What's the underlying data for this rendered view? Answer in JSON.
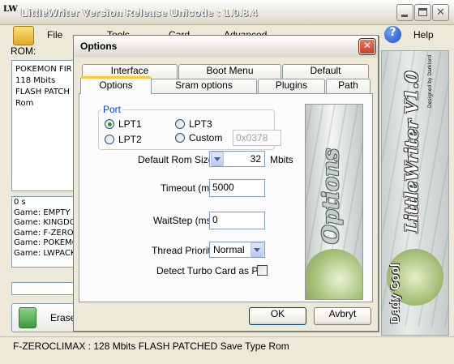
{
  "app": {
    "icon_text": "LW",
    "title": "LittleWriter Version Release Unicode : 1.0.8.4",
    "window_buttons": [
      "minimize-icon",
      "maximize-icon",
      "close-icon"
    ]
  },
  "toolbar": {
    "file": "File",
    "tools": "Tools",
    "card": "Card",
    "advanced": "Advanced",
    "help": "Help"
  },
  "rom": {
    "label": "ROM:",
    "lines": [
      "POKEMON FIR",
      "118 Mbits",
      "FLASH PATCH",
      "Rom"
    ]
  },
  "log": {
    "lines": [
      "0 s",
      "Game: EMPTY",
      "Game: KINGDO",
      "Game: F-ZERO",
      "Game: POKEMO",
      "Game: LWPACK"
    ]
  },
  "erase_label": "Erase",
  "status": "F-ZEROCLIMAX : 128 Mbits FLASH PATCHED Save Type Rom",
  "banner": {
    "title": "LittleWriter V1.0",
    "credit": "Designed by Darklord",
    "logo": "Dady Cool"
  },
  "dialog": {
    "title": "Options",
    "tabs_back": [
      "Interface",
      "Boot Menu",
      "Default"
    ],
    "tabs_front": [
      "Options",
      "Sram options",
      "Plugins",
      "Path"
    ],
    "active_tab": "Options",
    "port_group": {
      "label": "Port",
      "options": [
        "LPT1",
        "LPT2",
        "LPT3",
        "Custom"
      ],
      "selected": "LPT1",
      "custom_value": "0x0378"
    },
    "default_rom_size": {
      "label": "Default Rom Size:",
      "value": "32",
      "unit": "Mbits"
    },
    "timeout": {
      "label": "Timeout (ms)",
      "value": "5000"
    },
    "waitstep": {
      "label": "WaitStep (ms)",
      "value": "0"
    },
    "thread_priority": {
      "label": "Thread Priority",
      "value": "Normal"
    },
    "turbo": {
      "label": "Detect Turbo Card as Pro",
      "checked": false
    },
    "picture_text": "Options",
    "ok": "OK",
    "cancel": "Avbryt"
  },
  "colors": {
    "accent_tab": "#ffc83c",
    "close_red": "#c9401f",
    "field_border": "#7f9db9",
    "group_label": "#0046d5"
  }
}
